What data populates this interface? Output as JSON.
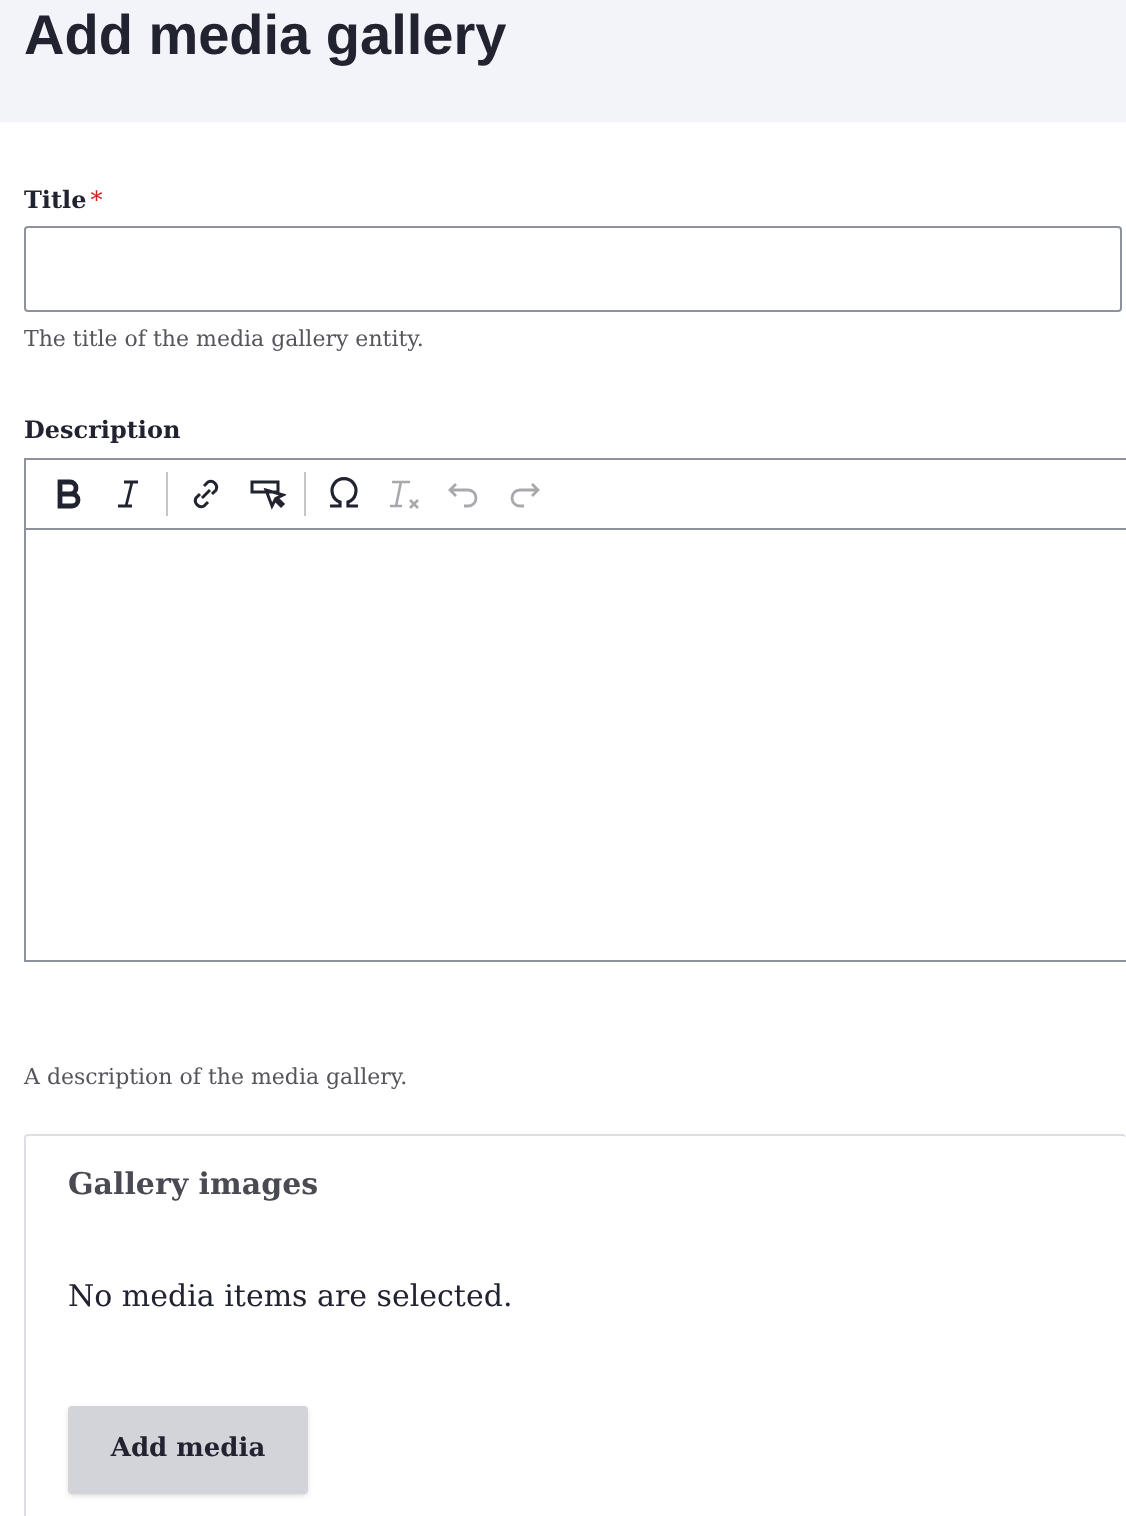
{
  "page_title": "Add media gallery",
  "title_field": {
    "label": "Title",
    "required": true,
    "required_mark": "*",
    "help": "The title of the media gallery entity."
  },
  "description_field": {
    "label": "Description",
    "help": "A description of the media gallery.",
    "toolbar": [
      [
        {
          "kind": "bold",
          "disabled": false
        },
        {
          "kind": "italic",
          "disabled": false
        }
      ],
      [
        {
          "kind": "link",
          "disabled": false
        },
        {
          "kind": "media",
          "disabled": false
        }
      ],
      [
        {
          "kind": "special-character",
          "disabled": false
        },
        {
          "kind": "remove-format",
          "disabled": true
        },
        {
          "kind": "undo",
          "disabled": true
        },
        {
          "kind": "redo",
          "disabled": true
        }
      ]
    ]
  },
  "gallery": {
    "legend": "Gallery images",
    "message": "No media items are selected.",
    "button": "Add media"
  }
}
